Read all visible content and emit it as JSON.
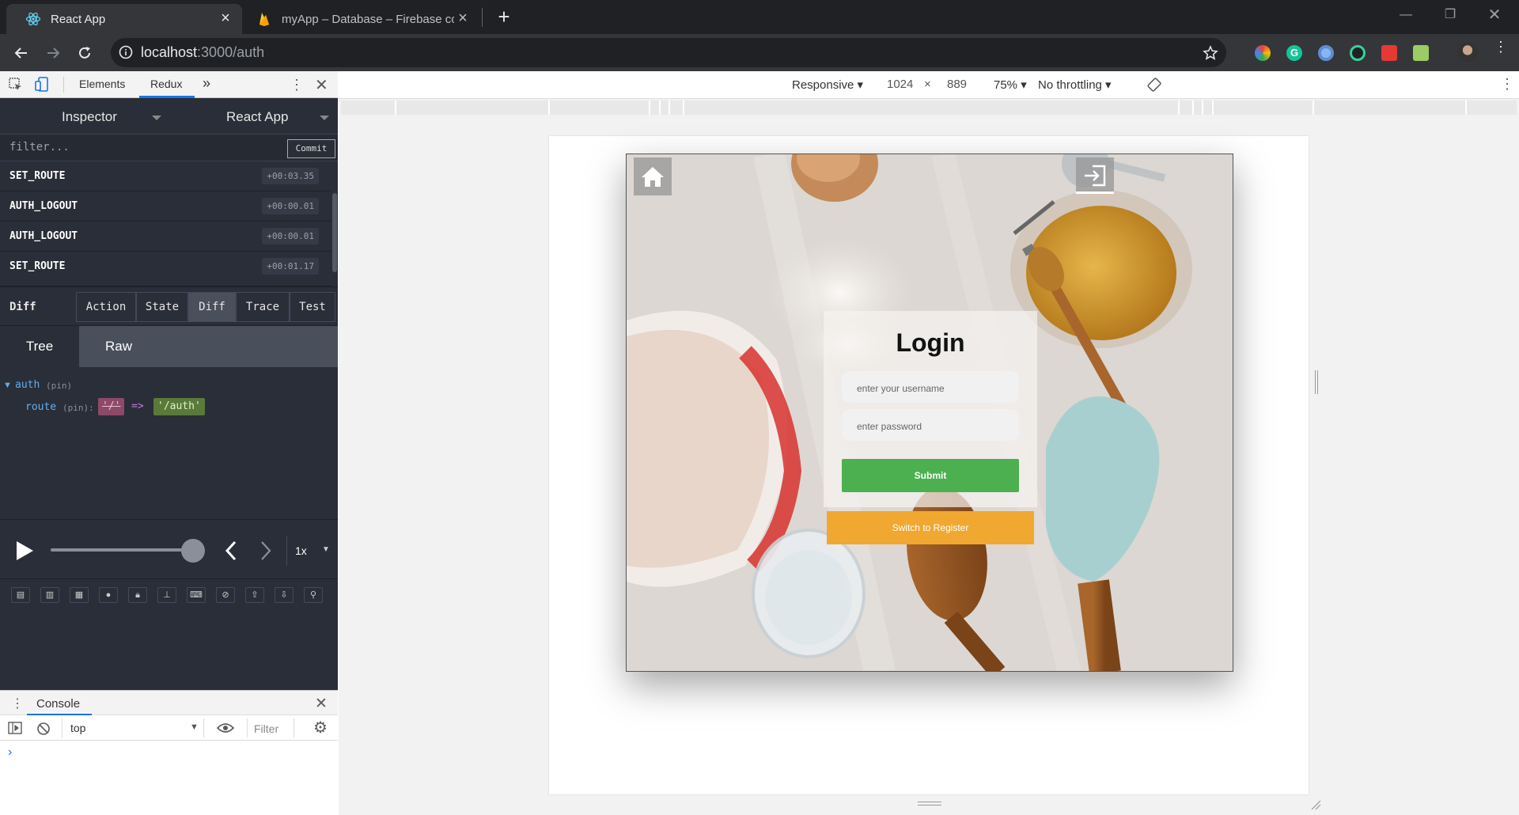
{
  "browser": {
    "tabs": [
      {
        "title": "React App",
        "icon": "react-icon",
        "active": true
      },
      {
        "title": "myApp – Database – Firebase co",
        "icon": "firebase-icon",
        "active": false
      }
    ],
    "new_tab": "+",
    "url_host": "localhost",
    "url_path": ":3000/auth"
  },
  "devtools": {
    "tabs": {
      "elements": "Elements",
      "redux": "Redux",
      "more": "»"
    },
    "inspector": {
      "left": "Inspector",
      "right": "React App"
    },
    "filter_placeholder": "filter...",
    "commit": "Commit",
    "actions": [
      {
        "name": "SET_ROUTE",
        "time": "+00:03.35"
      },
      {
        "name": "AUTH_LOGOUT",
        "time": "+00:00.01"
      },
      {
        "name": "AUTH_LOGOUT",
        "time": "+00:00.01"
      },
      {
        "name": "SET_ROUTE",
        "time": "+00:01.17"
      }
    ],
    "monitor": {
      "label": "Diff",
      "buttons": [
        "Action",
        "State",
        "Diff",
        "Trace",
        "Test"
      ],
      "selected": "Diff"
    },
    "view_tabs": {
      "tree": "Tree",
      "raw": "Raw"
    },
    "diff": {
      "key": "auth",
      "pin": "(pin)",
      "subkey": "route",
      "subpin": "(pin):",
      "old": "'/'",
      "arrow": "=>",
      "new": "'/auth'"
    },
    "player": {
      "speed": "1x"
    },
    "console": {
      "title": "Console",
      "context": "top",
      "filter": "Filter",
      "prompt": "›"
    }
  },
  "device_toolbar": {
    "mode": "Responsive",
    "width": "1024",
    "times": "×",
    "height": "889",
    "zoom": "75%",
    "throttle": "No throttling"
  },
  "app": {
    "login_title": "Login",
    "username_placeholder": "enter your username",
    "password_placeholder": "enter password",
    "submit": "Submit",
    "switch": "Switch to Register"
  },
  "colors": {
    "submit": "#4caf50",
    "switch": "#f0a830",
    "redux_bg": "#2a2e38"
  }
}
